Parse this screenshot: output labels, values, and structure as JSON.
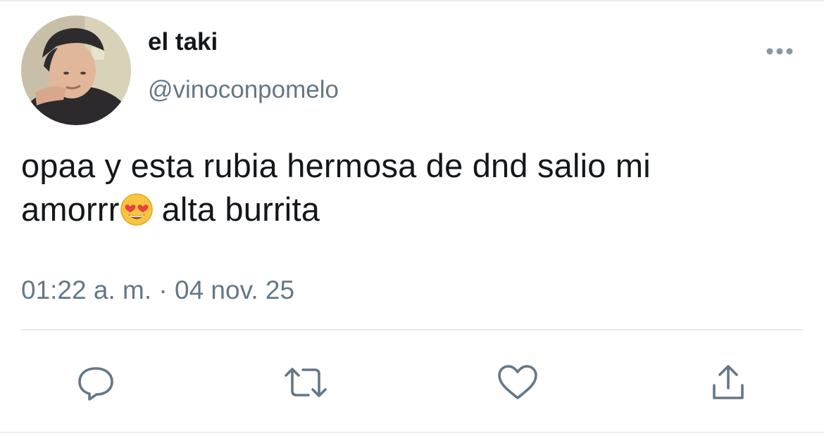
{
  "tweet": {
    "display_name": "el taki",
    "handle": "@vinoconpomelo",
    "text_line1": "opaa y esta rubia hermosa de dnd salio mi",
    "text_line2_before": "amorrr",
    "emoji": "smiling-face-with-heart-eyes",
    "text_line2_after": "alta burrita",
    "time": "01:22 a. m.",
    "separator": "·",
    "date": "04 nov. 25"
  },
  "actions": [
    {
      "icon": "reply-icon"
    },
    {
      "icon": "retweet-icon"
    },
    {
      "icon": "like-icon"
    },
    {
      "icon": "share-icon"
    }
  ],
  "colors": {
    "text": "#14171a",
    "secondary": "#657786",
    "divider": "#e6ecf0"
  }
}
